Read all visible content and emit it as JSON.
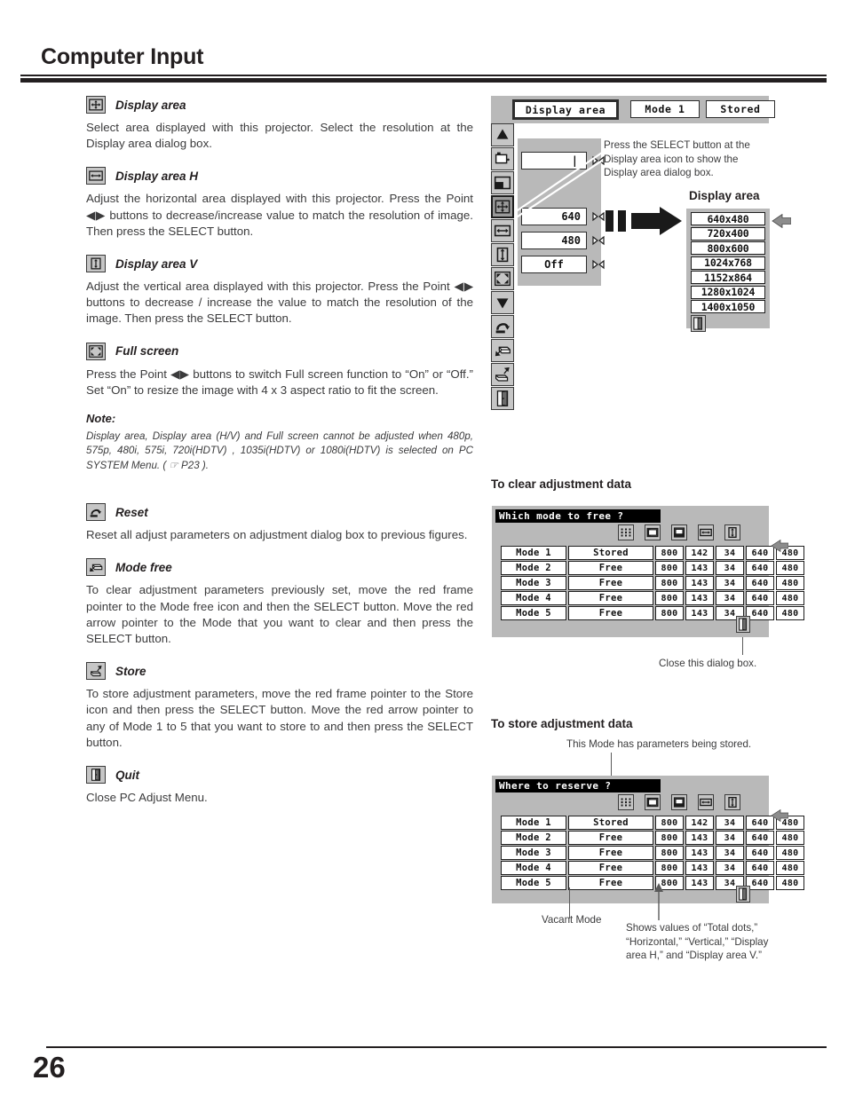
{
  "header": {
    "title": "Computer Input"
  },
  "footer": {
    "page_number": "26"
  },
  "sections": [
    {
      "icon": "display-area-icon",
      "title": "Display area",
      "body": "Select area displayed with this projector.  Select the resolution at the Display area dialog box."
    },
    {
      "icon": "display-area-h-icon",
      "title": "Display area H",
      "body": "Adjust the horizontal area displayed with this projector.  Press the Point ◀▶ buttons to decrease/increase value to match the resolution of image. Then press the SELECT button."
    },
    {
      "icon": "display-area-v-icon",
      "title": "Display area V",
      "body": "Adjust the vertical area displayed with this projector.  Press the Point ◀▶ buttons to decrease / increase the value to match the resolution of the image. Then press the SELECT button."
    },
    {
      "icon": "full-screen-icon",
      "title": "Full screen",
      "body": "Press the Point ◀▶ buttons to switch Full screen function to  “On” or “Off.”  Set “On” to resize the image with 4 x 3 aspect ratio to fit the screen."
    }
  ],
  "note": {
    "label": "Note:",
    "text": "Display area, Display area (H/V) and Full screen cannot be adjusted when 480p, 575p, 480i, 575i, 720i(HDTV) , 1035i(HDTV) or 1080i(HDTV) is selected on PC SYSTEM Menu.  ( ☞ P23 )."
  },
  "sections2": [
    {
      "icon": "reset-icon",
      "title": "Reset",
      "body": "Reset all adjust parameters on adjustment dialog box to previous figures."
    },
    {
      "icon": "mode-free-icon",
      "title": "Mode free",
      "body": "To clear adjustment parameters previously set, move the red frame pointer to the Mode free icon and then the SELECT button.  Move the red arrow pointer to the Mode that you want to clear and then press the SELECT button."
    },
    {
      "icon": "store-icon",
      "title": "Store",
      "body": "To store adjustment parameters, move the red frame pointer to the Store icon and then press the SELECT button.  Move the red arrow pointer to any of Mode 1 to 5 that you want to store to and then press the SELECT button."
    },
    {
      "icon": "quit-icon",
      "title": "Quit",
      "body": "Close PC Adjust Menu."
    }
  ],
  "osd": {
    "tab_display_area": "Display area",
    "tab_mode": "Mode 1",
    "tab_stored": "Stored",
    "values": {
      "blank": "",
      "h": "640",
      "v": "480",
      "full": "Off"
    },
    "note": "Press the SELECT button at the Display area icon to show the Display area dialog box.",
    "dialog_heading": "Display area",
    "resolutions": [
      "640x480",
      "720x400",
      "800x600",
      "1024x768",
      "1152x864",
      "1280x1024",
      "1400x1050"
    ]
  },
  "clear_table": {
    "heading": "To clear adjustment data",
    "title": "Which mode to free ?",
    "column_icons": [
      "total-dots-icon",
      "horizontal-icon",
      "vertical-icon",
      "display-area-h-icon",
      "display-area-v-icon"
    ],
    "rows": [
      {
        "mode": "Mode 1",
        "state": "Stored",
        "values": [
          "800",
          "142",
          "34",
          "640",
          "480"
        ]
      },
      {
        "mode": "Mode 2",
        "state": "Free",
        "values": [
          "800",
          "143",
          "34",
          "640",
          "480"
        ]
      },
      {
        "mode": "Mode 3",
        "state": "Free",
        "values": [
          "800",
          "143",
          "34",
          "640",
          "480"
        ]
      },
      {
        "mode": "Mode 4",
        "state": "Free",
        "values": [
          "800",
          "143",
          "34",
          "640",
          "480"
        ]
      },
      {
        "mode": "Mode 5",
        "state": "Free",
        "values": [
          "800",
          "143",
          "34",
          "640",
          "480"
        ]
      }
    ],
    "caption_close": "Close this dialog box."
  },
  "store_table": {
    "heading": "To store adjustment data",
    "title": "Where to reserve ?",
    "caption_top": "This Mode has parameters being stored.",
    "column_icons": [
      "total-dots-icon",
      "horizontal-icon",
      "vertical-icon",
      "display-area-h-icon",
      "display-area-v-icon"
    ],
    "rows": [
      {
        "mode": "Mode 1",
        "state": "Stored",
        "values": [
          "800",
          "142",
          "34",
          "640",
          "480"
        ]
      },
      {
        "mode": "Mode 2",
        "state": "Free",
        "values": [
          "800",
          "143",
          "34",
          "640",
          "480"
        ]
      },
      {
        "mode": "Mode 3",
        "state": "Free",
        "values": [
          "800",
          "143",
          "34",
          "640",
          "480"
        ]
      },
      {
        "mode": "Mode 4",
        "state": "Free",
        "values": [
          "800",
          "143",
          "34",
          "640",
          "480"
        ]
      },
      {
        "mode": "Mode 5",
        "state": "Free",
        "values": [
          "800",
          "143",
          "34",
          "640",
          "480"
        ]
      }
    ],
    "caption_vacant": "Vacant Mode",
    "caption_values": "Shows values of “Total dots,” “Horizontal,” “Vertical,” “Display area H,” and “Display area V.”"
  }
}
